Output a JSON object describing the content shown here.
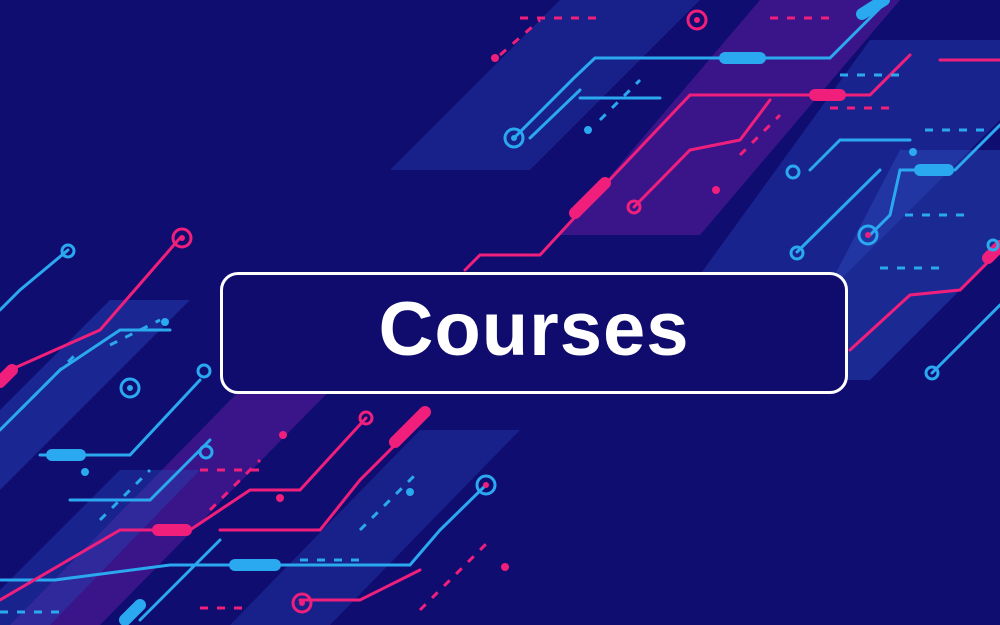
{
  "banner": {
    "title": "Courses",
    "colors": {
      "background": "#100d70",
      "cyan": "#2aa8f0",
      "magenta": "#f01f7c",
      "purple_band": "#4a1d9a",
      "blue_band": "#1f3aa8",
      "border": "#ffffff",
      "text": "#ffffff"
    }
  }
}
